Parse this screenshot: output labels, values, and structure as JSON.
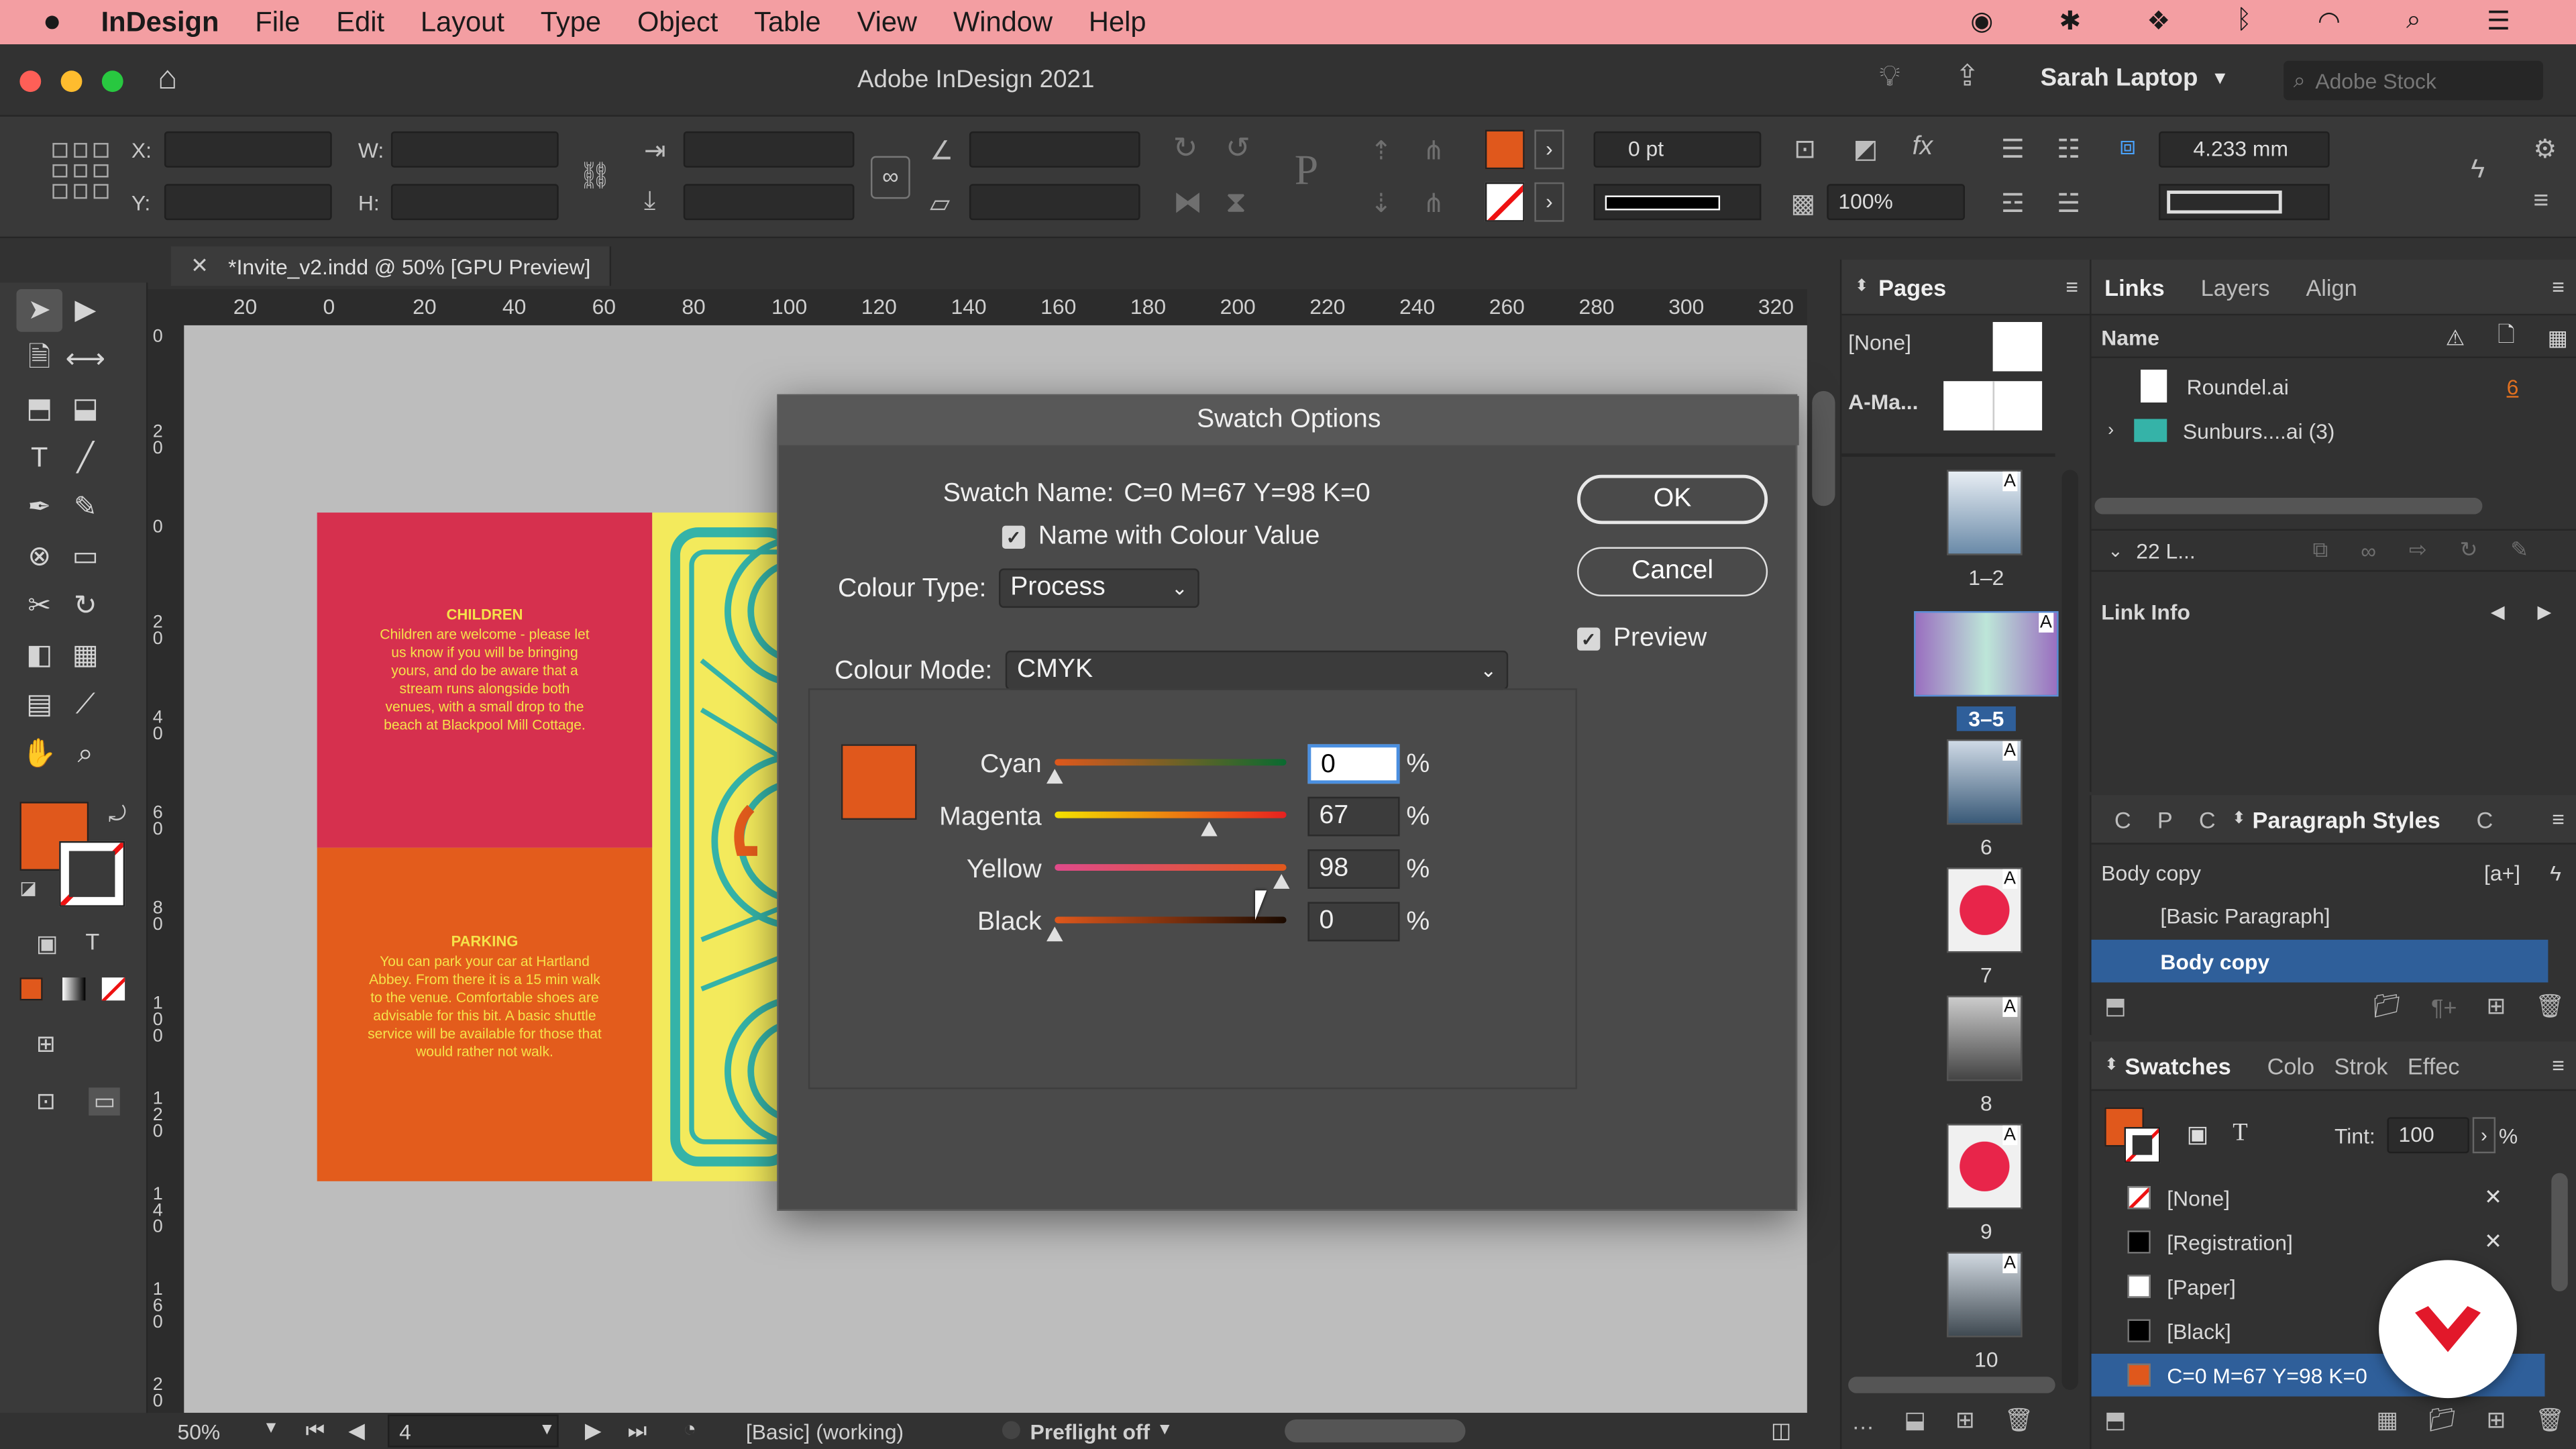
{
  "menubar": {
    "app": "InDesign",
    "items": [
      "File",
      "Edit",
      "Layout",
      "Type",
      "Object",
      "Table",
      "View",
      "Window",
      "Help"
    ]
  },
  "titlebar": {
    "title": "Adobe InDesign 2021",
    "user": "Sarah Laptop",
    "stock_placeholder": "Adobe Stock"
  },
  "control": {
    "x_label": "X:",
    "y_label": "Y:",
    "w_label": "W:",
    "h_label": "H:",
    "stroke_weight": "0 pt",
    "opacity": "100%",
    "gap_value": "4.233 mm",
    "fill_color": "#e0581c"
  },
  "doc_tab": {
    "title": "*Invite_v2.indd @ 50% [GPU Preview]"
  },
  "ruler": {
    "ticks": [
      "20",
      "0",
      "20",
      "40",
      "60",
      "80",
      "100",
      "120",
      "140",
      "160",
      "180",
      "200",
      "220",
      "240",
      "260",
      "280",
      "300",
      "320"
    ],
    "vticks": [
      "0",
      "2 0",
      "0",
      "2 0",
      "4 0",
      "6 0",
      "8 0",
      "1 0 0",
      "1 2 0",
      "1 4 0",
      "1 6 0",
      "2 0"
    ]
  },
  "page_content": {
    "children_title": "CHILDREN",
    "children_body": "Children are welcome - please let us know if you will be bringing yours, and do be aware that a stream runs alongside both venues, with a small drop to the beach at Blackpool Mill Cottage.",
    "parking_title": "PARKING",
    "parking_body": "You can park your car at Hartland Abbey. From there it is a 15 min walk to the venue. Comfortable shoes are advisable for this bit. A basic shuttle service will be available for those that would rather not walk.",
    "pink": "#d6304e",
    "orange": "#e35c1c",
    "yellow": "#f3ea5c",
    "teal": "#35b3a8"
  },
  "status": {
    "zoom": "50%",
    "page": "4",
    "master": "[Basic] (working)",
    "preflight": "Preflight off"
  },
  "dialog": {
    "title": "Swatch Options",
    "swatch_name_label": "Swatch Name:",
    "swatch_name": "C=0 M=67 Y=98 K=0",
    "name_with_value": "Name with Colour Value",
    "colour_type_label": "Colour Type:",
    "colour_type": "Process",
    "colour_mode_label": "Colour Mode:",
    "colour_mode": "CMYK",
    "ok": "OK",
    "cancel": "Cancel",
    "preview": "Preview",
    "swatch_color": "#e0581c",
    "percent": "%",
    "channels": [
      {
        "name": "Cyan",
        "value": "0",
        "level": 0
      },
      {
        "name": "Magenta",
        "value": "67",
        "level": 67
      },
      {
        "name": "Yellow",
        "value": "98",
        "level": 98
      },
      {
        "name": "Black",
        "value": "0",
        "level": 0
      }
    ]
  },
  "pages_panel": {
    "tab": "Pages",
    "none": "[None]",
    "master": "A-Ma...",
    "labels": [
      "1–2",
      "3–5",
      "6",
      "7",
      "8",
      "9",
      "10"
    ],
    "badge": "A"
  },
  "links_panel": {
    "tabs": [
      "Links",
      "Layers",
      "Align"
    ],
    "name_header": "Name",
    "items": [
      {
        "name": "Roundel.ai",
        "page": "6"
      },
      {
        "name": "Sunburs....ai (3)",
        "page": ""
      }
    ],
    "count": "22 L...",
    "link_info": "Link Info"
  },
  "para_panel": {
    "tabs": [
      "C",
      "P",
      "C",
      "Paragraph Styles",
      "C"
    ],
    "current": "Body copy",
    "items": [
      "[Basic Paragraph]",
      "Body copy"
    ]
  },
  "swatches_panel": {
    "tabs": [
      "Swatches",
      "Colo",
      "Strok",
      "Effec"
    ],
    "tint_label": "Tint:",
    "tint": "100",
    "percent": "%",
    "items": [
      {
        "name": "[None]",
        "color": "#ffffff"
      },
      {
        "name": "[Registration]",
        "color": "#000000"
      },
      {
        "name": "[Paper]",
        "color": "#ffffff"
      },
      {
        "name": "[Black]",
        "color": "#000000"
      },
      {
        "name": "C=0 M=67 Y=98 K=0",
        "color": "#e0581c"
      }
    ]
  }
}
